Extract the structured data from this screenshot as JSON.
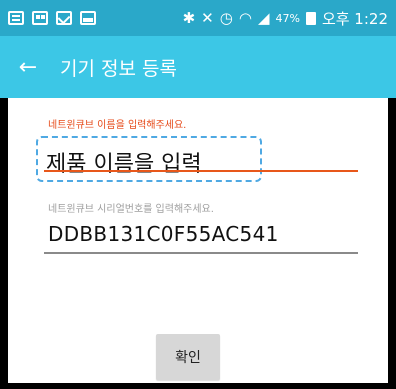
{
  "statusbar": {
    "icons": [
      "message-icon",
      "grid-icon",
      "mail-icon",
      "image-icon",
      "bluetooth-icon",
      "mute-icon",
      "alarm-icon",
      "wifi-icon",
      "signal-icon"
    ],
    "battery": "47%",
    "time": "오후 1:22"
  },
  "appbar": {
    "back_label": "←",
    "title": "기기 정보 등록"
  },
  "form": {
    "name_label": "네트윈큐브 이름을 입력해주세요.",
    "name_placeholder": "제품 이름을 입력",
    "serial_label": "네트윈큐브 시리얼번호를 입력해주세요.",
    "serial_value": "DDBB131C0F55AC541"
  },
  "actions": {
    "confirm_label": "확인"
  },
  "colors": {
    "status_bar": "#2aa8c9",
    "app_bar": "#3cc7e6",
    "error_text": "#e64a19",
    "active_underline": "#e8571a",
    "focus_outline": "#4fa9e3"
  }
}
